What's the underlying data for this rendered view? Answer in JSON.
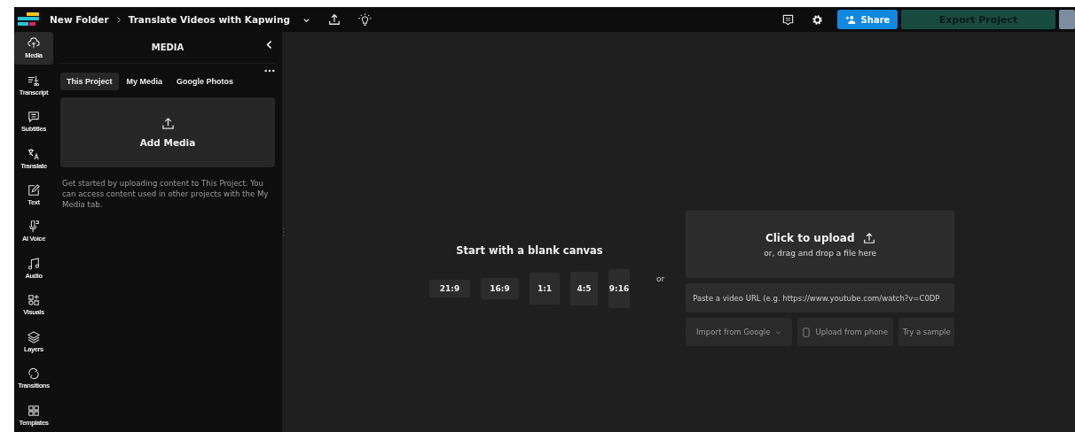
{
  "header": {
    "breadcrumb": [
      "New Folder",
      "Translate Videos with Kapwing"
    ],
    "share": "Share",
    "export": "Export Project"
  },
  "sidebar": {
    "items": [
      {
        "label": "Media",
        "selected": true
      },
      {
        "label": "Transcript",
        "selected": false
      },
      {
        "label": "Subtitles",
        "selected": false
      },
      {
        "label": "Translate",
        "selected": false
      },
      {
        "label": "Text",
        "selected": false
      },
      {
        "label": "AI Voice",
        "selected": false
      },
      {
        "label": "Audio",
        "selected": false
      },
      {
        "label": "Visuals",
        "selected": false
      },
      {
        "label": "Layers",
        "selected": false
      },
      {
        "label": "Transitions",
        "selected": false
      },
      {
        "label": "Templates",
        "selected": false
      }
    ]
  },
  "panel": {
    "title": "MEDIA",
    "tabs": [
      {
        "label": "This Project",
        "selected": true
      },
      {
        "label": "My Media",
        "selected": false
      },
      {
        "label": "Google Photos",
        "selected": false
      }
    ],
    "add_media": "Add Media",
    "help": "Get started by uploading content to This Project. You can access content used in other projects with the My Media tab."
  },
  "canvas": {
    "blank_title": "Start with a blank canvas",
    "ratios": [
      "21:9",
      "16:9",
      "1:1",
      "4:5",
      "9:16"
    ],
    "or": "or",
    "upload_title": "Click to upload",
    "upload_sub": "or, drag and drop a file here",
    "url_placeholder": "Paste a video URL (e.g. https://www.youtube.com/watch?v=C0DP",
    "import_google": "Import from Google",
    "upload_phone": "Upload from phone",
    "try_sample": "Try a sample"
  }
}
